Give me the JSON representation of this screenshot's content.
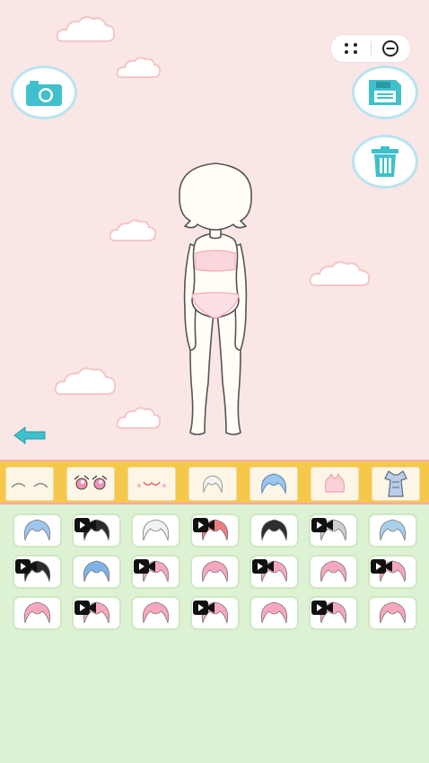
{
  "app": {
    "name": "dress-up"
  },
  "capsule": {
    "more_icon": "more-dots-icon",
    "close_icon": "minimize-circle-icon"
  },
  "buttons": {
    "camera": {
      "icon": "camera-icon"
    },
    "save": {
      "icon": "save-disk-icon"
    },
    "delete": {
      "icon": "trash-icon"
    },
    "back": {
      "icon": "back-arrow-icon"
    }
  },
  "categories": [
    {
      "id": "eyebrows",
      "icon": "eyebrows-icon",
      "selected": false
    },
    {
      "id": "eyes",
      "icon": "eyes-icon",
      "selected": false
    },
    {
      "id": "mouth",
      "icon": "mouth-icon",
      "selected": false
    },
    {
      "id": "hair-front",
      "icon": "hair-front-icon",
      "selected": false
    },
    {
      "id": "hair",
      "icon": "hair-icon",
      "selected": true
    },
    {
      "id": "accessory",
      "icon": "accessory-icon",
      "selected": false
    },
    {
      "id": "outfit",
      "icon": "outfit-icon",
      "selected": false
    }
  ],
  "hair_items": [
    {
      "color": "#9cc6ee",
      "locked_video": false
    },
    {
      "color": "#2b2b2b",
      "locked_video": true
    },
    {
      "color": "#f2f2f2",
      "locked_video": false
    },
    {
      "color": "#f07a80",
      "locked_video": true
    },
    {
      "color": "#2e2e2e",
      "locked_video": false
    },
    {
      "color": "#cfcfcf",
      "locked_video": true
    },
    {
      "color": "#a9d0ea",
      "locked_video": false
    },
    {
      "color": "#2b2b2b",
      "locked_video": true
    },
    {
      "color": "#7fb2e6",
      "locked_video": false
    },
    {
      "color": "#f7a7bd",
      "locked_video": true
    },
    {
      "color": "#f7a7bd",
      "locked_video": false
    },
    {
      "color": "#f7a7bd",
      "locked_video": true
    },
    {
      "color": "#f7a7bd",
      "locked_video": false
    },
    {
      "color": "#f7a7bd",
      "locked_video": true
    },
    {
      "color": "#f7a7bd",
      "locked_video": false
    },
    {
      "color": "#f7a7bd",
      "locked_video": true
    },
    {
      "color": "#f7a7bd",
      "locked_video": false
    },
    {
      "color": "#f7a7bd",
      "locked_video": true
    },
    {
      "color": "#f7a7bd",
      "locked_video": false
    },
    {
      "color": "#f7a7bd",
      "locked_video": true
    },
    {
      "color": "#f7a7bd",
      "locked_video": false
    }
  ],
  "colors": {
    "stage_bg": "#fbe6e6",
    "toolbar": "#f6c84a",
    "panel_bg": "#ddf2d2",
    "accent_blue": "#3fc0cc"
  }
}
